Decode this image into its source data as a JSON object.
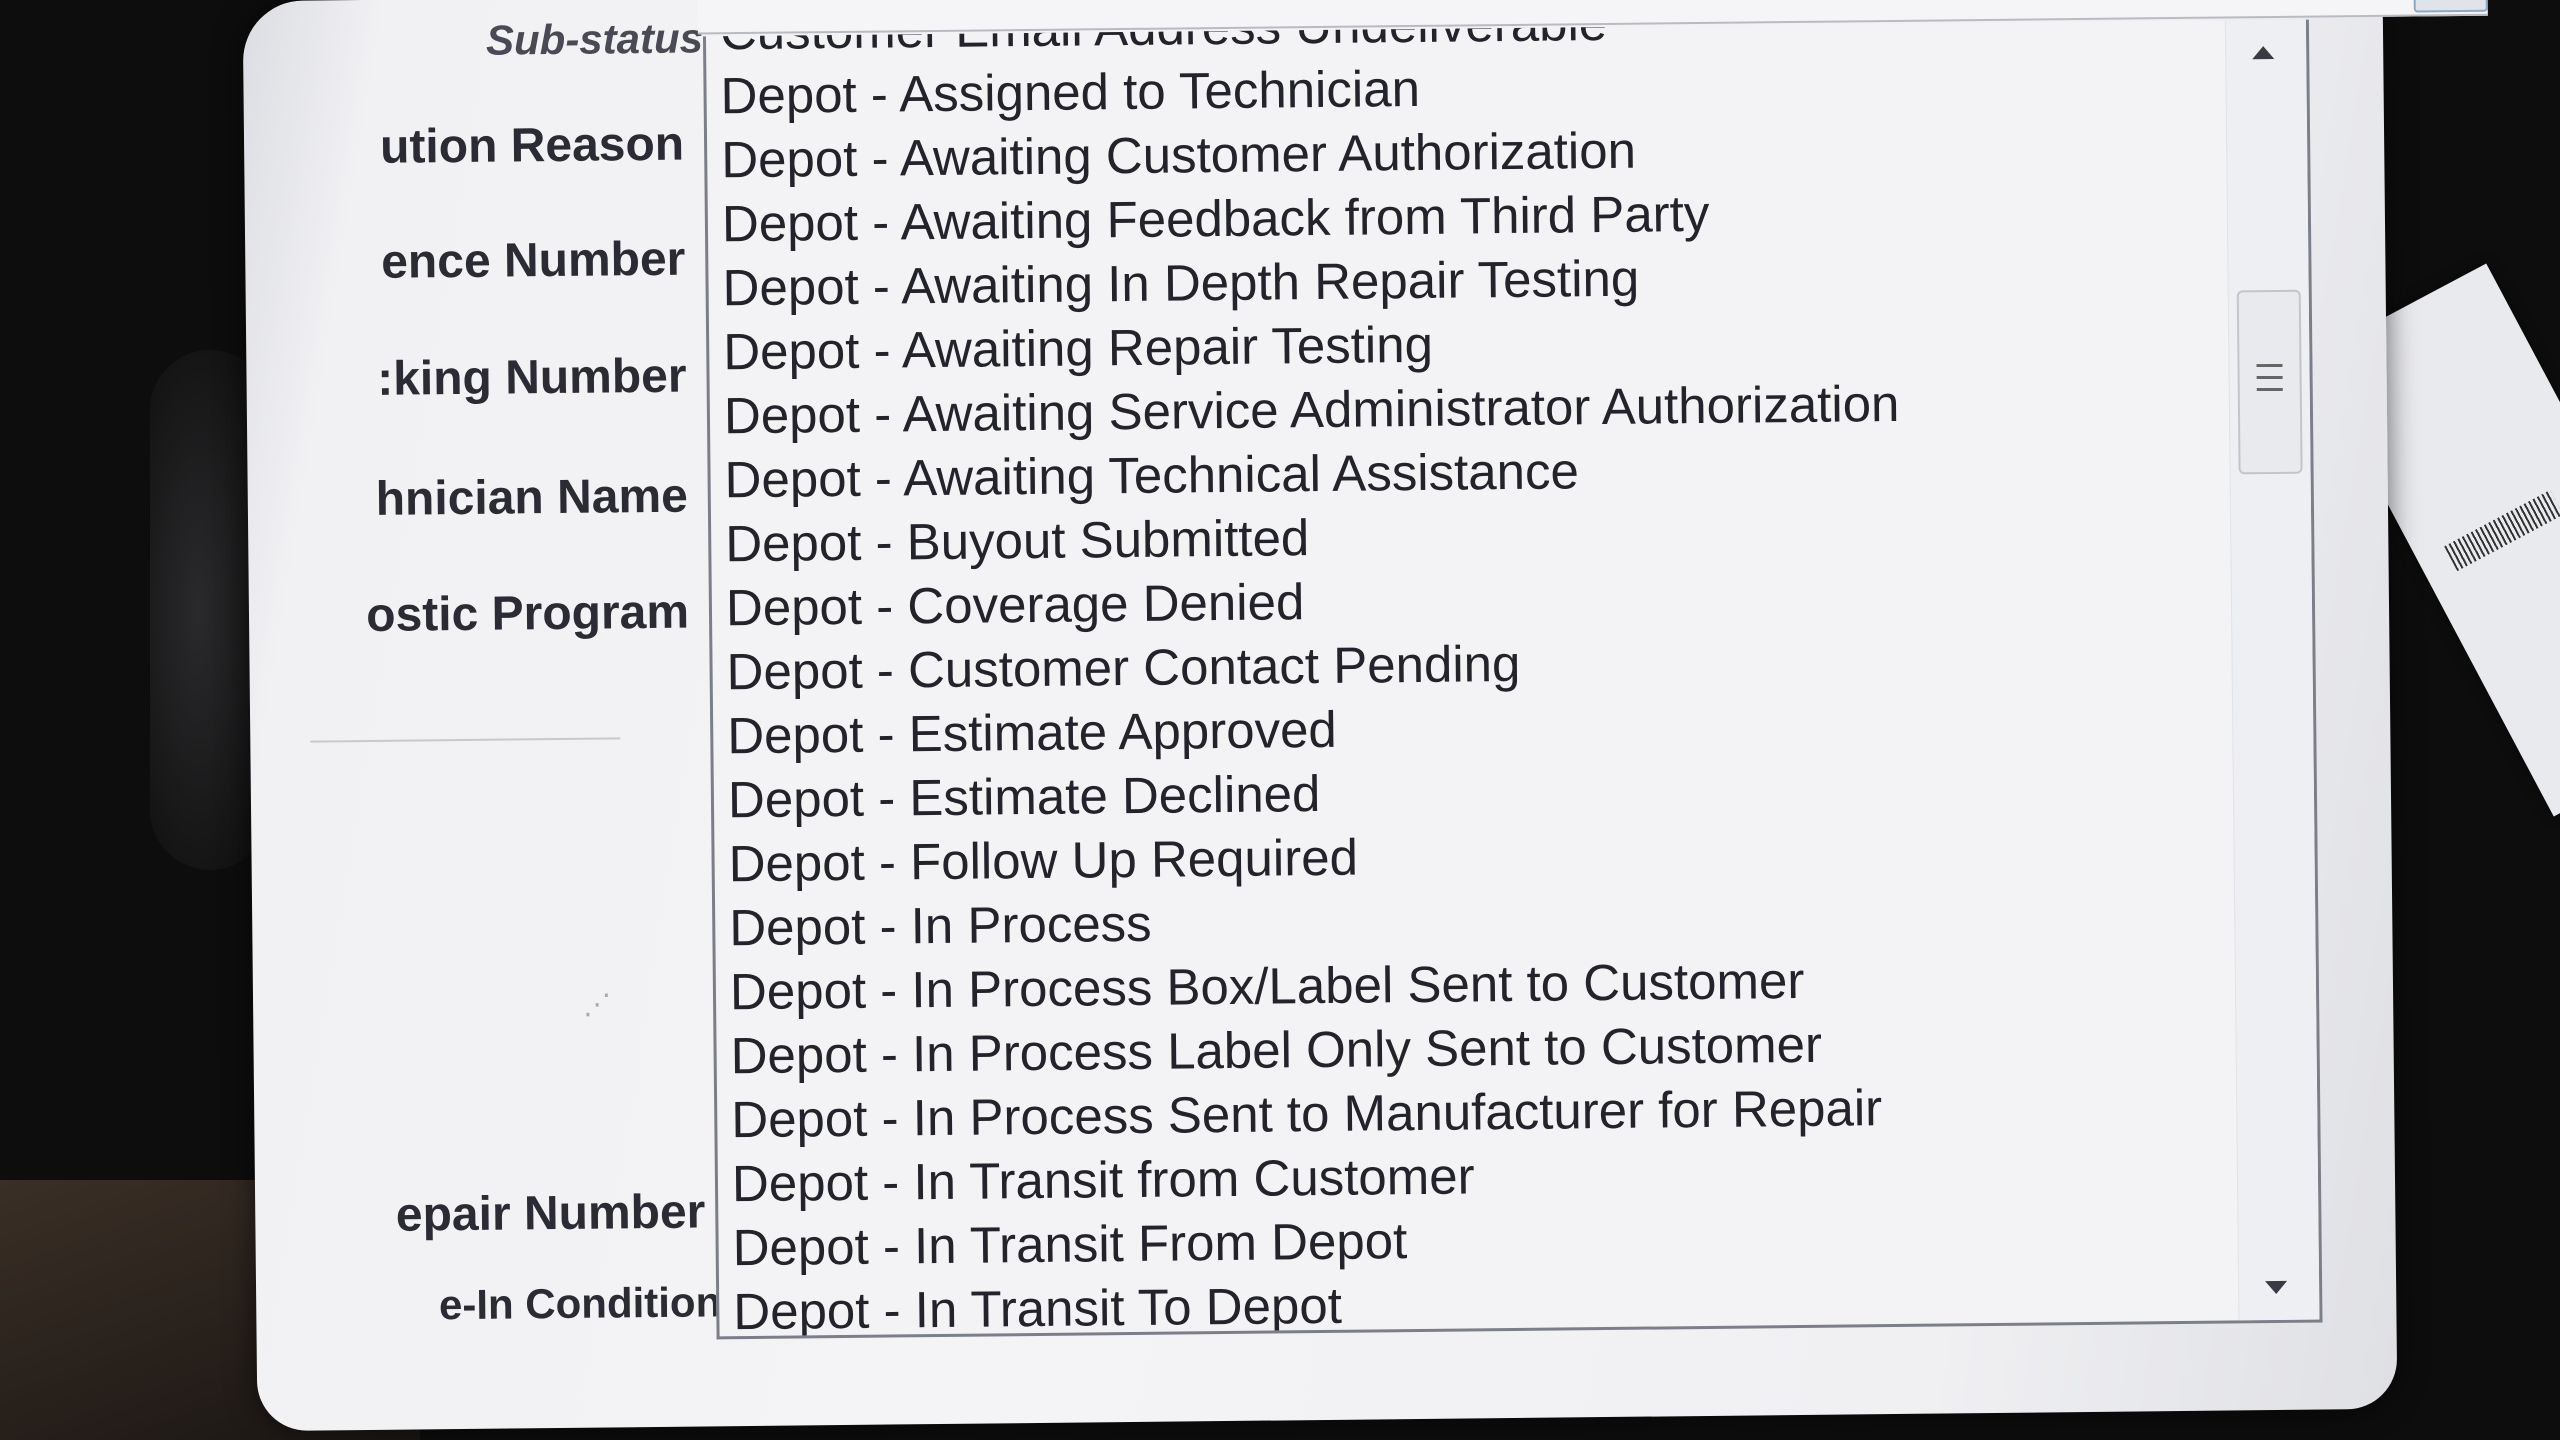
{
  "labels": {
    "sub_status": "Sub-status",
    "resolution_reason": "ution Reason",
    "reference_number": "ence Number",
    "tracking_number": ":king Number",
    "technician_name": "hnician Name",
    "diagnostic_program": "ostic Program",
    "repair_number": "epair Number",
    "checkin_condition": "e-In Condition"
  },
  "dropdown": {
    "options": [
      "Customer Email Address Undeliverable",
      "Depot - Assigned to Technician",
      "Depot - Awaiting Customer Authorization",
      "Depot - Awaiting Feedback from Third Party",
      "Depot - Awaiting In Depth Repair Testing",
      "Depot - Awaiting Repair Testing",
      "Depot - Awaiting Service Administrator Authorization",
      "Depot - Awaiting Technical Assistance",
      "Depot - Buyout Submitted",
      "Depot - Coverage Denied",
      "Depot - Customer Contact Pending",
      "Depot - Estimate Approved",
      "Depot - Estimate Declined",
      "Depot - Follow Up Required",
      "Depot - In Process",
      "Depot - In Process Box/Label Sent to Customer",
      "Depot - In Process Label Only Sent to Customer",
      "Depot - In Process Sent to Manufacturer for Repair",
      "Depot - In Transit from Customer",
      "Depot - In Transit From Depot",
      "Depot - In Transit To Depot"
    ]
  },
  "icons": {
    "dropdown_toggle": "chevron-down-icon",
    "scroll_up": "arrow-up-icon",
    "scroll_down": "arrow-down-icon",
    "scroll_thumb": "grip-lines-icon",
    "resize_grip": "resize-grip-icon"
  }
}
